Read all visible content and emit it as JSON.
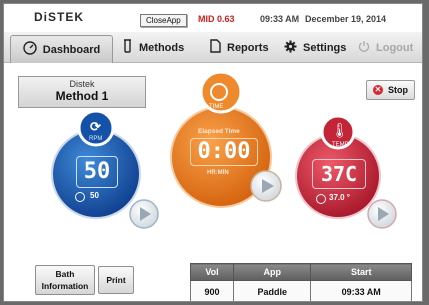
{
  "header": {
    "logo": "DiSTEK",
    "close_app": "CloseApp",
    "mid": "MID 0.63",
    "time": "09:33 AM",
    "date": "December 19, 2014"
  },
  "nav": {
    "dashboard": "Dashboard",
    "methods": "Methods",
    "reports": "Reports",
    "settings": "Settings",
    "logout": "Logout"
  },
  "method": {
    "line1": "Distek",
    "line2": "Method 1"
  },
  "stop_label": "Stop",
  "rpm": {
    "label": "RPM",
    "value": "50",
    "setpoint": "50",
    "color": "#1a56b0"
  },
  "timer": {
    "label": "TIME",
    "title": "Elapsed Time",
    "value": "0:00",
    "unit": "HR:MIN",
    "color": "#e77a1b"
  },
  "temp": {
    "label": "TEMP",
    "value": "37C",
    "setpoint": "37.0 °",
    "color": "#c8283b"
  },
  "buttons": {
    "bath_line1": "Bath",
    "bath_line2": "Information",
    "print": "Print"
  },
  "table": {
    "headers": [
      "Vol",
      "App",
      "Start"
    ],
    "row": [
      "900",
      "Paddle",
      "09:33 AM"
    ]
  }
}
